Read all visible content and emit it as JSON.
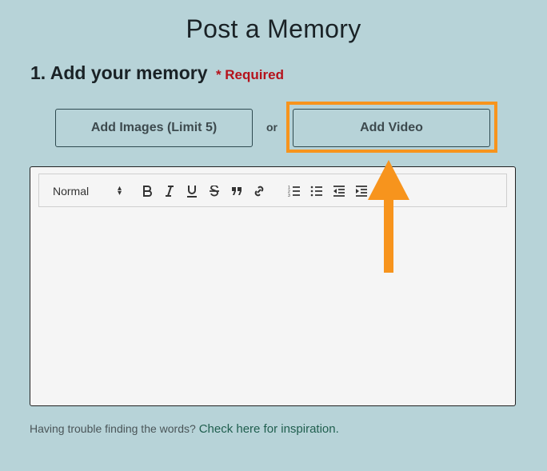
{
  "page": {
    "title": "Post a Memory"
  },
  "section": {
    "heading": "1. Add your memory",
    "required": "* Required"
  },
  "buttons": {
    "add_images": "Add Images (Limit 5)",
    "or": "or",
    "add_video": "Add Video"
  },
  "editor": {
    "format_select": "Normal",
    "toolbar_icons": [
      "bold-icon",
      "italic-icon",
      "underline-icon",
      "strikethrough-icon",
      "blockquote-icon",
      "link-icon",
      "ordered-list-icon",
      "bullet-list-icon",
      "outdent-icon",
      "indent-icon"
    ]
  },
  "help": {
    "text": "Having trouble finding the words?",
    "link": "Check here for inspiration."
  },
  "colors": {
    "background": "#b7d3d8",
    "highlight": "#f7941d",
    "required": "#b5121b",
    "link": "#1f5e4e"
  }
}
